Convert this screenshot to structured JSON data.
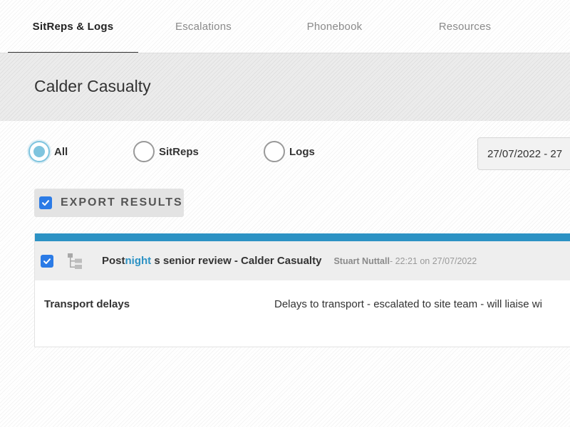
{
  "tabs": [
    {
      "label": "SitReps & Logs",
      "active": true
    },
    {
      "label": "Escalations",
      "active": false
    },
    {
      "label": "Phonebook",
      "active": false
    },
    {
      "label": "Resources",
      "active": false
    }
  ],
  "page": {
    "title": "Calder Casualty"
  },
  "filters": {
    "options": [
      {
        "label": "All",
        "selected": true
      },
      {
        "label": "SitReps",
        "selected": false
      },
      {
        "label": "Logs",
        "selected": false
      }
    ],
    "date_range": "27/07/2022 - 27"
  },
  "export": {
    "label": "EXPORT RESULTS",
    "checked": true
  },
  "results": [
    {
      "checked": true,
      "icon": "hierarchy-icon",
      "title_prefix": "Post",
      "title_highlight": "night",
      "title_suffix": " s senior review - Calder Casualty",
      "author": "Stuart Nuttall",
      "time_text": " - 22:21 on 27/07/2022",
      "row_label": "Transport delays",
      "row_text": "Delays to transport - escalated to site team - will liaise wi"
    }
  ],
  "colors": {
    "accent": "#2c92c4",
    "radio_selected": "#7fc4de",
    "checkbox": "#2b7be6"
  }
}
